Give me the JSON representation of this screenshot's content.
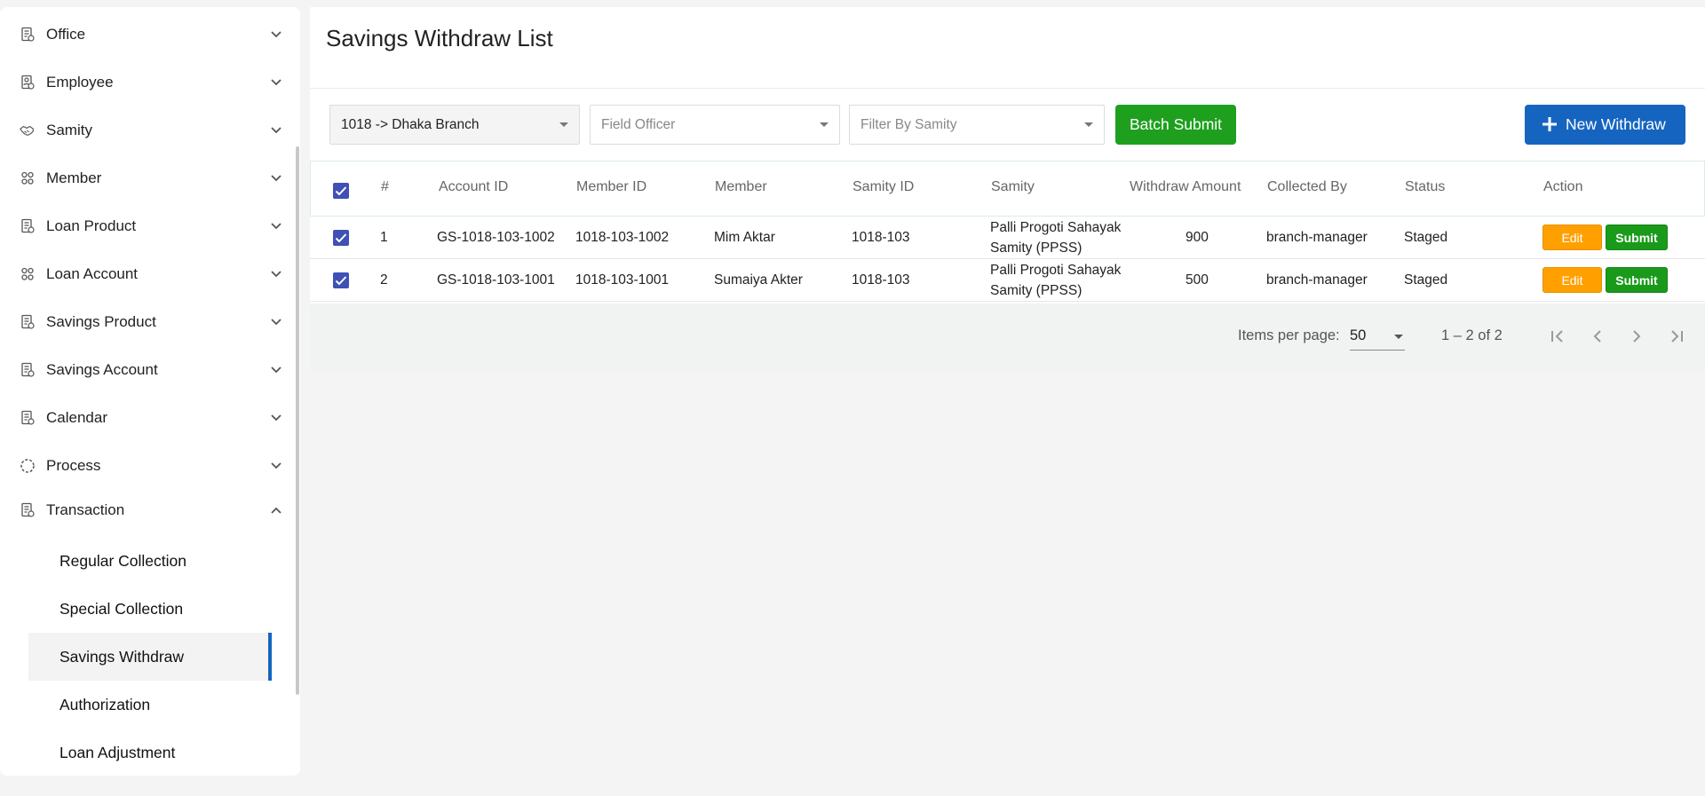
{
  "sidebar": {
    "items": [
      {
        "label": "Office",
        "icon": "document-icon"
      },
      {
        "label": "Employee",
        "icon": "id-card-icon"
      },
      {
        "label": "Samity",
        "icon": "handshake-icon"
      },
      {
        "label": "Member",
        "icon": "group-icon"
      },
      {
        "label": "Loan Product",
        "icon": "document-icon"
      },
      {
        "label": "Loan Account",
        "icon": "group-icon"
      },
      {
        "label": "Savings Product",
        "icon": "document-icon"
      },
      {
        "label": "Savings Account",
        "icon": "document-icon"
      },
      {
        "label": "Calendar",
        "icon": "document-icon"
      },
      {
        "label": "Process",
        "icon": "circle-dashed-icon"
      },
      {
        "label": "Transaction",
        "icon": "document-icon",
        "expanded": true
      }
    ],
    "sub_items": [
      {
        "label": "Regular Collection"
      },
      {
        "label": "Special Collection"
      },
      {
        "label": "Savings Withdraw",
        "active": true
      },
      {
        "label": "Authorization"
      },
      {
        "label": "Loan Adjustment"
      }
    ]
  },
  "page": {
    "title": "Savings Withdraw List"
  },
  "filters": {
    "branch": "1018 -> Dhaka Branch",
    "field_officer_placeholder": "Field Officer",
    "samity_placeholder": "Filter By Samity"
  },
  "actions": {
    "batch_submit": "Batch Submit",
    "new_withdraw": "New Withdraw"
  },
  "table": {
    "headers": {
      "index": "#",
      "account_id": "Account ID",
      "member_id": "Member ID",
      "member": "Member",
      "samity_id": "Samity ID",
      "samity": "Samity",
      "amount": "Withdraw Amount",
      "collected_by": "Collected By",
      "status": "Status",
      "action": "Action"
    },
    "rows": [
      {
        "index": "1",
        "account_id": "GS-1018-103-1002",
        "member_id": "1018-103-1002",
        "member": "Mim Aktar",
        "samity_id": "1018-103",
        "samity_line1": "Palli Progoti Sahayak",
        "samity_line2": "Samity (PPSS)",
        "amount": "900",
        "collected_by": "branch-manager",
        "status": "Staged",
        "edit": "Edit",
        "submit": "Submit"
      },
      {
        "index": "2",
        "account_id": "GS-1018-103-1001",
        "member_id": "1018-103-1001",
        "member": "Sumaiya Akter",
        "samity_id": "1018-103",
        "samity_line1": "Palli Progoti Sahayak",
        "samity_line2": "Samity (PPSS)",
        "amount": "500",
        "collected_by": "branch-manager",
        "status": "Staged",
        "edit": "Edit",
        "submit": "Submit"
      }
    ]
  },
  "pagination": {
    "items_per_page_label": "Items per page:",
    "items_per_page": "50",
    "range": "1 – 2 of 2"
  },
  "colors": {
    "primary": "#1565c0",
    "success": "#1ea01e",
    "warning": "#ffa000",
    "checkbox": "#3f51b5"
  }
}
